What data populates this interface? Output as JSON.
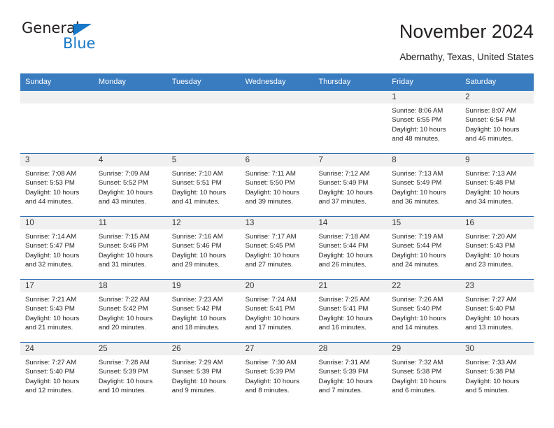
{
  "brand": {
    "name_top": "General",
    "name_bottom": "Blue",
    "accent_color": "#1878c8"
  },
  "header": {
    "title": "November 2024",
    "subtitle": "Abernathy, Texas, United States"
  },
  "theme": {
    "header_blue": "#3a7cc0",
    "row_divider_blue": "#2f6eb5",
    "date_strip_gray": "#f0f0f0",
    "text_color": "#231f20"
  },
  "calendar": {
    "weekdays": [
      "Sunday",
      "Monday",
      "Tuesday",
      "Wednesday",
      "Thursday",
      "Friday",
      "Saturday"
    ],
    "weeks": [
      [
        {
          "day": "",
          "empty": true
        },
        {
          "day": "",
          "empty": true
        },
        {
          "day": "",
          "empty": true
        },
        {
          "day": "",
          "empty": true
        },
        {
          "day": "",
          "empty": true
        },
        {
          "day": "1",
          "sunrise": "Sunrise: 8:06 AM",
          "sunset": "Sunset: 6:55 PM",
          "daylight1": "Daylight: 10 hours",
          "daylight2": "and 48 minutes."
        },
        {
          "day": "2",
          "sunrise": "Sunrise: 8:07 AM",
          "sunset": "Sunset: 6:54 PM",
          "daylight1": "Daylight: 10 hours",
          "daylight2": "and 46 minutes."
        }
      ],
      [
        {
          "day": "3",
          "sunrise": "Sunrise: 7:08 AM",
          "sunset": "Sunset: 5:53 PM",
          "daylight1": "Daylight: 10 hours",
          "daylight2": "and 44 minutes."
        },
        {
          "day": "4",
          "sunrise": "Sunrise: 7:09 AM",
          "sunset": "Sunset: 5:52 PM",
          "daylight1": "Daylight: 10 hours",
          "daylight2": "and 43 minutes."
        },
        {
          "day": "5",
          "sunrise": "Sunrise: 7:10 AM",
          "sunset": "Sunset: 5:51 PM",
          "daylight1": "Daylight: 10 hours",
          "daylight2": "and 41 minutes."
        },
        {
          "day": "6",
          "sunrise": "Sunrise: 7:11 AM",
          "sunset": "Sunset: 5:50 PM",
          "daylight1": "Daylight: 10 hours",
          "daylight2": "and 39 minutes."
        },
        {
          "day": "7",
          "sunrise": "Sunrise: 7:12 AM",
          "sunset": "Sunset: 5:49 PM",
          "daylight1": "Daylight: 10 hours",
          "daylight2": "and 37 minutes."
        },
        {
          "day": "8",
          "sunrise": "Sunrise: 7:13 AM",
          "sunset": "Sunset: 5:49 PM",
          "daylight1": "Daylight: 10 hours",
          "daylight2": "and 36 minutes."
        },
        {
          "day": "9",
          "sunrise": "Sunrise: 7:13 AM",
          "sunset": "Sunset: 5:48 PM",
          "daylight1": "Daylight: 10 hours",
          "daylight2": "and 34 minutes."
        }
      ],
      [
        {
          "day": "10",
          "sunrise": "Sunrise: 7:14 AM",
          "sunset": "Sunset: 5:47 PM",
          "daylight1": "Daylight: 10 hours",
          "daylight2": "and 32 minutes."
        },
        {
          "day": "11",
          "sunrise": "Sunrise: 7:15 AM",
          "sunset": "Sunset: 5:46 PM",
          "daylight1": "Daylight: 10 hours",
          "daylight2": "and 31 minutes."
        },
        {
          "day": "12",
          "sunrise": "Sunrise: 7:16 AM",
          "sunset": "Sunset: 5:46 PM",
          "daylight1": "Daylight: 10 hours",
          "daylight2": "and 29 minutes."
        },
        {
          "day": "13",
          "sunrise": "Sunrise: 7:17 AM",
          "sunset": "Sunset: 5:45 PM",
          "daylight1": "Daylight: 10 hours",
          "daylight2": "and 27 minutes."
        },
        {
          "day": "14",
          "sunrise": "Sunrise: 7:18 AM",
          "sunset": "Sunset: 5:44 PM",
          "daylight1": "Daylight: 10 hours",
          "daylight2": "and 26 minutes."
        },
        {
          "day": "15",
          "sunrise": "Sunrise: 7:19 AM",
          "sunset": "Sunset: 5:44 PM",
          "daylight1": "Daylight: 10 hours",
          "daylight2": "and 24 minutes."
        },
        {
          "day": "16",
          "sunrise": "Sunrise: 7:20 AM",
          "sunset": "Sunset: 5:43 PM",
          "daylight1": "Daylight: 10 hours",
          "daylight2": "and 23 minutes."
        }
      ],
      [
        {
          "day": "17",
          "sunrise": "Sunrise: 7:21 AM",
          "sunset": "Sunset: 5:43 PM",
          "daylight1": "Daylight: 10 hours",
          "daylight2": "and 21 minutes."
        },
        {
          "day": "18",
          "sunrise": "Sunrise: 7:22 AM",
          "sunset": "Sunset: 5:42 PM",
          "daylight1": "Daylight: 10 hours",
          "daylight2": "and 20 minutes."
        },
        {
          "day": "19",
          "sunrise": "Sunrise: 7:23 AM",
          "sunset": "Sunset: 5:42 PM",
          "daylight1": "Daylight: 10 hours",
          "daylight2": "and 18 minutes."
        },
        {
          "day": "20",
          "sunrise": "Sunrise: 7:24 AM",
          "sunset": "Sunset: 5:41 PM",
          "daylight1": "Daylight: 10 hours",
          "daylight2": "and 17 minutes."
        },
        {
          "day": "21",
          "sunrise": "Sunrise: 7:25 AM",
          "sunset": "Sunset: 5:41 PM",
          "daylight1": "Daylight: 10 hours",
          "daylight2": "and 16 minutes."
        },
        {
          "day": "22",
          "sunrise": "Sunrise: 7:26 AM",
          "sunset": "Sunset: 5:40 PM",
          "daylight1": "Daylight: 10 hours",
          "daylight2": "and 14 minutes."
        },
        {
          "day": "23",
          "sunrise": "Sunrise: 7:27 AM",
          "sunset": "Sunset: 5:40 PM",
          "daylight1": "Daylight: 10 hours",
          "daylight2": "and 13 minutes."
        }
      ],
      [
        {
          "day": "24",
          "sunrise": "Sunrise: 7:27 AM",
          "sunset": "Sunset: 5:40 PM",
          "daylight1": "Daylight: 10 hours",
          "daylight2": "and 12 minutes."
        },
        {
          "day": "25",
          "sunrise": "Sunrise: 7:28 AM",
          "sunset": "Sunset: 5:39 PM",
          "daylight1": "Daylight: 10 hours",
          "daylight2": "and 10 minutes."
        },
        {
          "day": "26",
          "sunrise": "Sunrise: 7:29 AM",
          "sunset": "Sunset: 5:39 PM",
          "daylight1": "Daylight: 10 hours",
          "daylight2": "and 9 minutes."
        },
        {
          "day": "27",
          "sunrise": "Sunrise: 7:30 AM",
          "sunset": "Sunset: 5:39 PM",
          "daylight1": "Daylight: 10 hours",
          "daylight2": "and 8 minutes."
        },
        {
          "day": "28",
          "sunrise": "Sunrise: 7:31 AM",
          "sunset": "Sunset: 5:39 PM",
          "daylight1": "Daylight: 10 hours",
          "daylight2": "and 7 minutes."
        },
        {
          "day": "29",
          "sunrise": "Sunrise: 7:32 AM",
          "sunset": "Sunset: 5:38 PM",
          "daylight1": "Daylight: 10 hours",
          "daylight2": "and 6 minutes."
        },
        {
          "day": "30",
          "sunrise": "Sunrise: 7:33 AM",
          "sunset": "Sunset: 5:38 PM",
          "daylight1": "Daylight: 10 hours",
          "daylight2": "and 5 minutes."
        }
      ]
    ]
  }
}
